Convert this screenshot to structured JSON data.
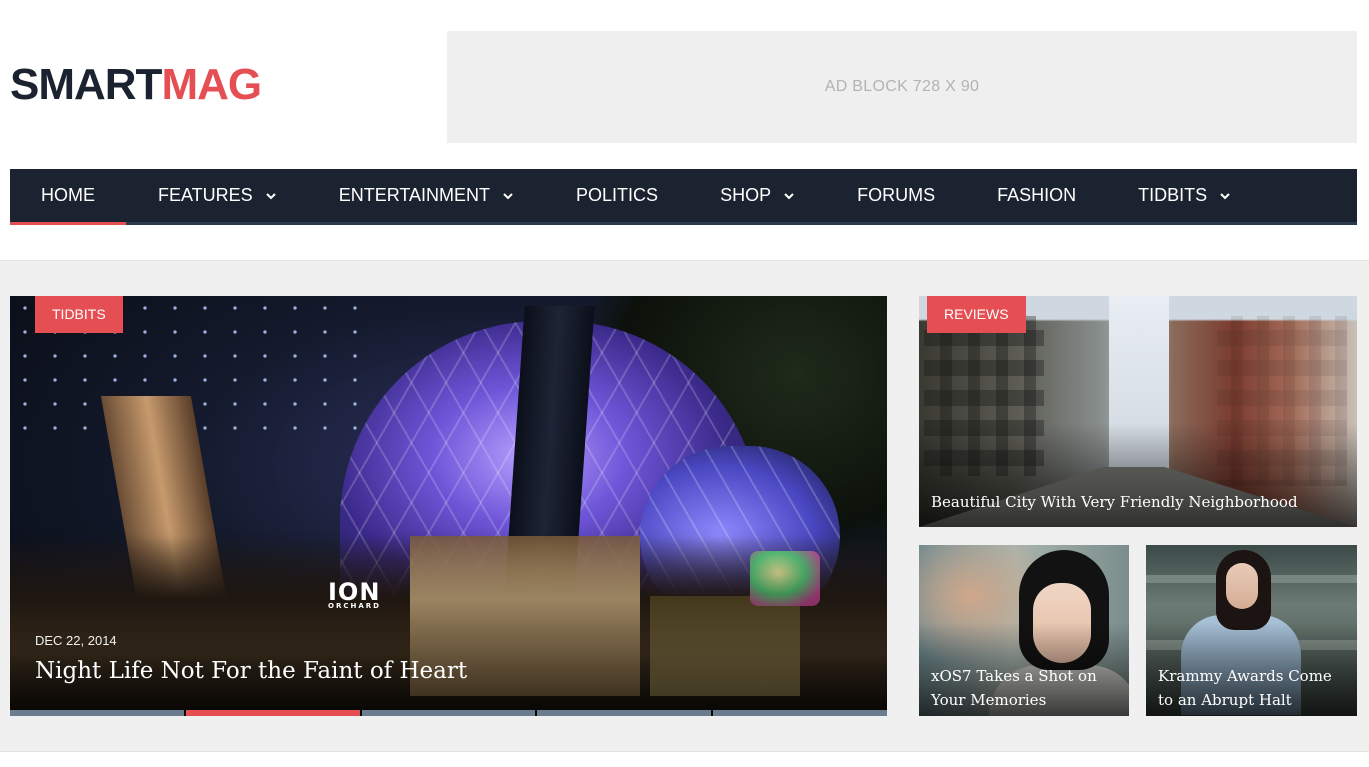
{
  "header": {
    "logo_part1": "SMART",
    "logo_part2": "MAG",
    "ad_text": "AD BLOCK  728 X 90"
  },
  "nav": {
    "items": [
      {
        "label": "HOME",
        "active": true,
        "dropdown": false
      },
      {
        "label": "FEATURES",
        "dropdown": true
      },
      {
        "label": "ENTERTAINMENT",
        "dropdown": true
      },
      {
        "label": "POLITICS",
        "dropdown": false
      },
      {
        "label": "SHOP",
        "dropdown": true
      },
      {
        "label": "FORUMS",
        "dropdown": false
      },
      {
        "label": "FASHION",
        "dropdown": false
      },
      {
        "label": "TIDBITS",
        "dropdown": true
      }
    ]
  },
  "featured": {
    "main": {
      "category": "TIDBITS",
      "date": "DEC 22, 2014",
      "title": "Night Life Not For the Faint of Heart",
      "sign": "ION",
      "sign_sub": "ORCHARD"
    },
    "slider_pages": 5,
    "slider_active": 2,
    "side_top": {
      "category": "REVIEWS",
      "title": "Beautiful City With Very Friendly Neighborhood"
    },
    "side_left": {
      "title_line1": "xOS7 Takes a Shot on",
      "title_line2": "Your Memories"
    },
    "side_right": {
      "title_line1": "Krammy Awards Come",
      "title_line2": "to an Abrupt Halt"
    }
  },
  "colors": {
    "accent": "#e54e53",
    "nav_bg": "#1c2330",
    "logo_dark": "#1b2230",
    "band_bg": "#f0f0f0"
  },
  "icons": {
    "dropdown": "chevron-down-icon"
  }
}
